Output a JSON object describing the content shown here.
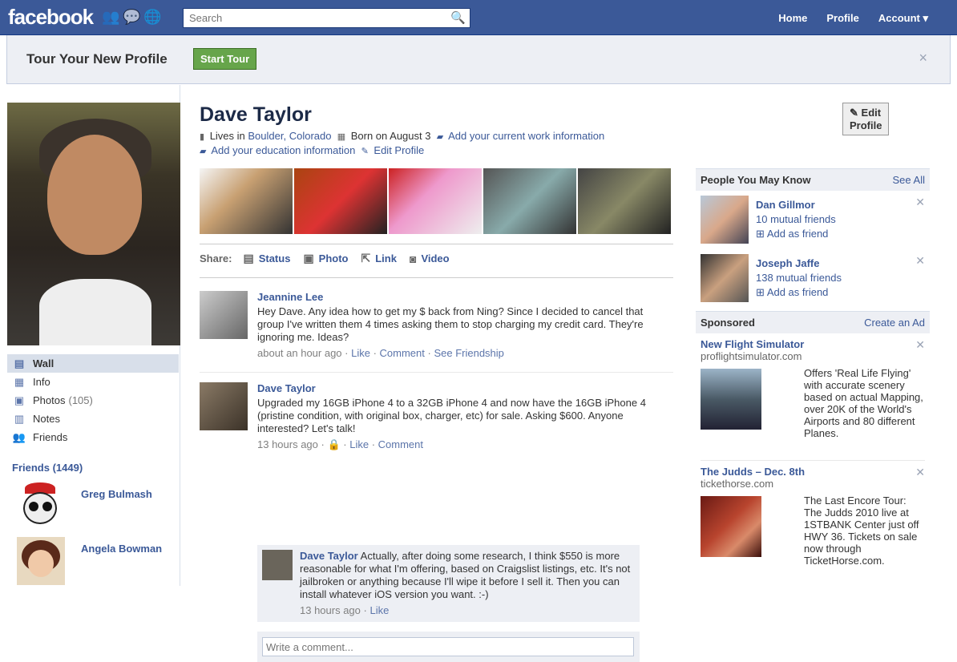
{
  "topbar": {
    "logo": "facebook",
    "search_placeholder": "Search",
    "nav": [
      "Home",
      "Profile",
      "Account ▾"
    ],
    "colors": {
      "brand": "#3b5998"
    }
  },
  "tour": {
    "title": "Tour Your New Profile",
    "start_button": "Start Tour",
    "close": "×"
  },
  "leftnav": {
    "items": [
      {
        "label": "Wall",
        "icon": "wall-icon"
      },
      {
        "label": "Info",
        "icon": "info-icon"
      },
      {
        "label": "Photos",
        "count": "(105)",
        "icon": "photos-icon"
      },
      {
        "label": "Notes",
        "icon": "notes-icon"
      },
      {
        "label": "Friends",
        "icon": "friends-icon"
      }
    ],
    "friends_title": "Friends",
    "friends_count": "(1449)",
    "friends": [
      {
        "name": "Greg Bulmash"
      },
      {
        "name": "Angela Bowman"
      }
    ]
  },
  "profile": {
    "name": "Dave Taylor",
    "edit_button": "Edit Profile",
    "lives_prefix": "Lives in",
    "lives_place": "Boulder, Colorado",
    "born": "Born on August 3",
    "add_work": "Add your current work information",
    "add_education": "Add your education information",
    "edit_link": "Edit Profile"
  },
  "share": {
    "label": "Share:",
    "items": [
      "Status",
      "Photo",
      "Link",
      "Video"
    ]
  },
  "posts": [
    {
      "author": "Jeannine Lee",
      "text": "Hey Dave. Any idea how to get my $ back from Ning? Since I decided to cancel that group I've written them 4 times asking them to stop charging my credit card. They're ignoring me. Ideas?",
      "time": "about an hour ago",
      "actions": [
        "Like",
        "Comment",
        "See Friendship"
      ]
    },
    {
      "author": "Dave Taylor",
      "text": "Upgraded my 16GB iPhone 4 to a 32GB iPhone 4 and now have the 16GB iPhone 4 (pristine condition, with original box, charger, etc) for sale. Asking $600. Anyone interested? Let's talk!",
      "time": "13 hours ago",
      "actions": [
        "Like",
        "Comment"
      ],
      "comment": {
        "author": "Dave Taylor",
        "text": "Actually, after doing some research, I think $550 is more reasonable for what I'm offering, based on Craigslist listings, etc. It's not jailbroken or anything because I'll wipe it before I sell it. Then you can install whatever iOS version you want. :-)",
        "time": "13 hours ago",
        "action": "Like"
      },
      "comment_placeholder": "Write a comment..."
    }
  ],
  "pymk": {
    "title": "People You May Know",
    "see_all": "See All",
    "people": [
      {
        "name": "Dan Gillmor",
        "mutual": "10 mutual friends",
        "add": "Add as friend"
      },
      {
        "name": "Joseph Jaffe",
        "mutual": "138 mutual friends",
        "add": "Add as friend"
      }
    ]
  },
  "sponsored": {
    "title": "Sponsored",
    "create": "Create an Ad",
    "ads": [
      {
        "title": "New Flight Simulator",
        "domain": "proflightsimulator.com",
        "text": "Offers 'Real Life Flying' with accurate scenery based on actual Mapping, over 20K of the World's Airports and 80 different Planes."
      },
      {
        "title": "The Judds – Dec. 8th",
        "domain": "tickethorse.com",
        "text": "The Last Encore Tour: The Judds 2010 live at 1STBANK Center just off HWY 36. Tickets on sale now through TicketHorse.com."
      }
    ]
  }
}
